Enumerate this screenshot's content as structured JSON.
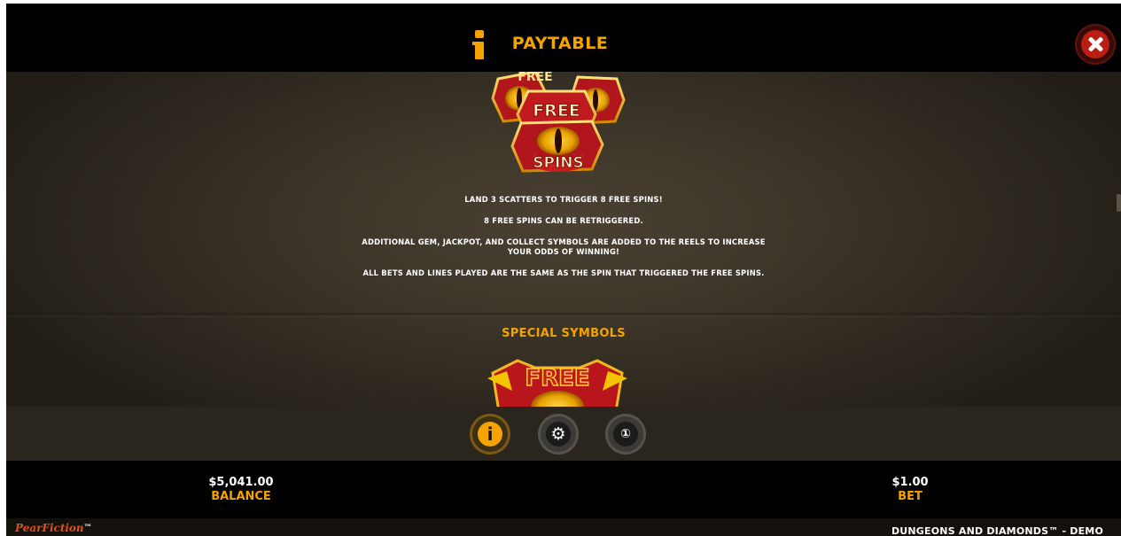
{
  "header": {
    "title": "PAYTABLE",
    "info_icon": "info-icon",
    "close_icon": "close-icon"
  },
  "paytable": {
    "rules": [
      "LAND 3 SCATTERS TO TRIGGER 8 FREE SPINS!",
      "8 FREE SPINS CAN BE RETRIGGERED.",
      "ADDITIONAL GEM, JACKPOT, AND COLLECT SYMBOLS ARE ADDED TO THE REELS TO INCREASE YOUR ODDS OF WINNING!",
      "ALL BETS AND LINES PLAYED ARE THE SAME AS THE SPIN THAT TRIGGERED THE FREE SPINS."
    ],
    "section_title": "SPECIAL SYMBOLS",
    "symbol_top": {
      "line1": "FREE",
      "line2": "FREE",
      "line3": "SPINS"
    },
    "symbol_bottom": {
      "line1": "FREE"
    }
  },
  "menu": {
    "info_icon": "info-icon",
    "settings_icon": "gear-icon",
    "history_icon": "award-ribbon-icon",
    "info_glyph": "i",
    "settings_glyph": "⚙",
    "history_glyph": "①"
  },
  "status": {
    "balance_value": "$5,041.00",
    "balance_label": "BALANCE",
    "bet_value": "$1.00",
    "bet_label": "BET"
  },
  "footer": {
    "brand": "PearFiction",
    "brand_tm": "™",
    "game_name": "DUNGEONS AND DIAMONDS™ - DEMO"
  },
  "colors": {
    "accent": "#f5a300",
    "close_red": "#b81e14",
    "brand_orange": "#e0501c"
  }
}
